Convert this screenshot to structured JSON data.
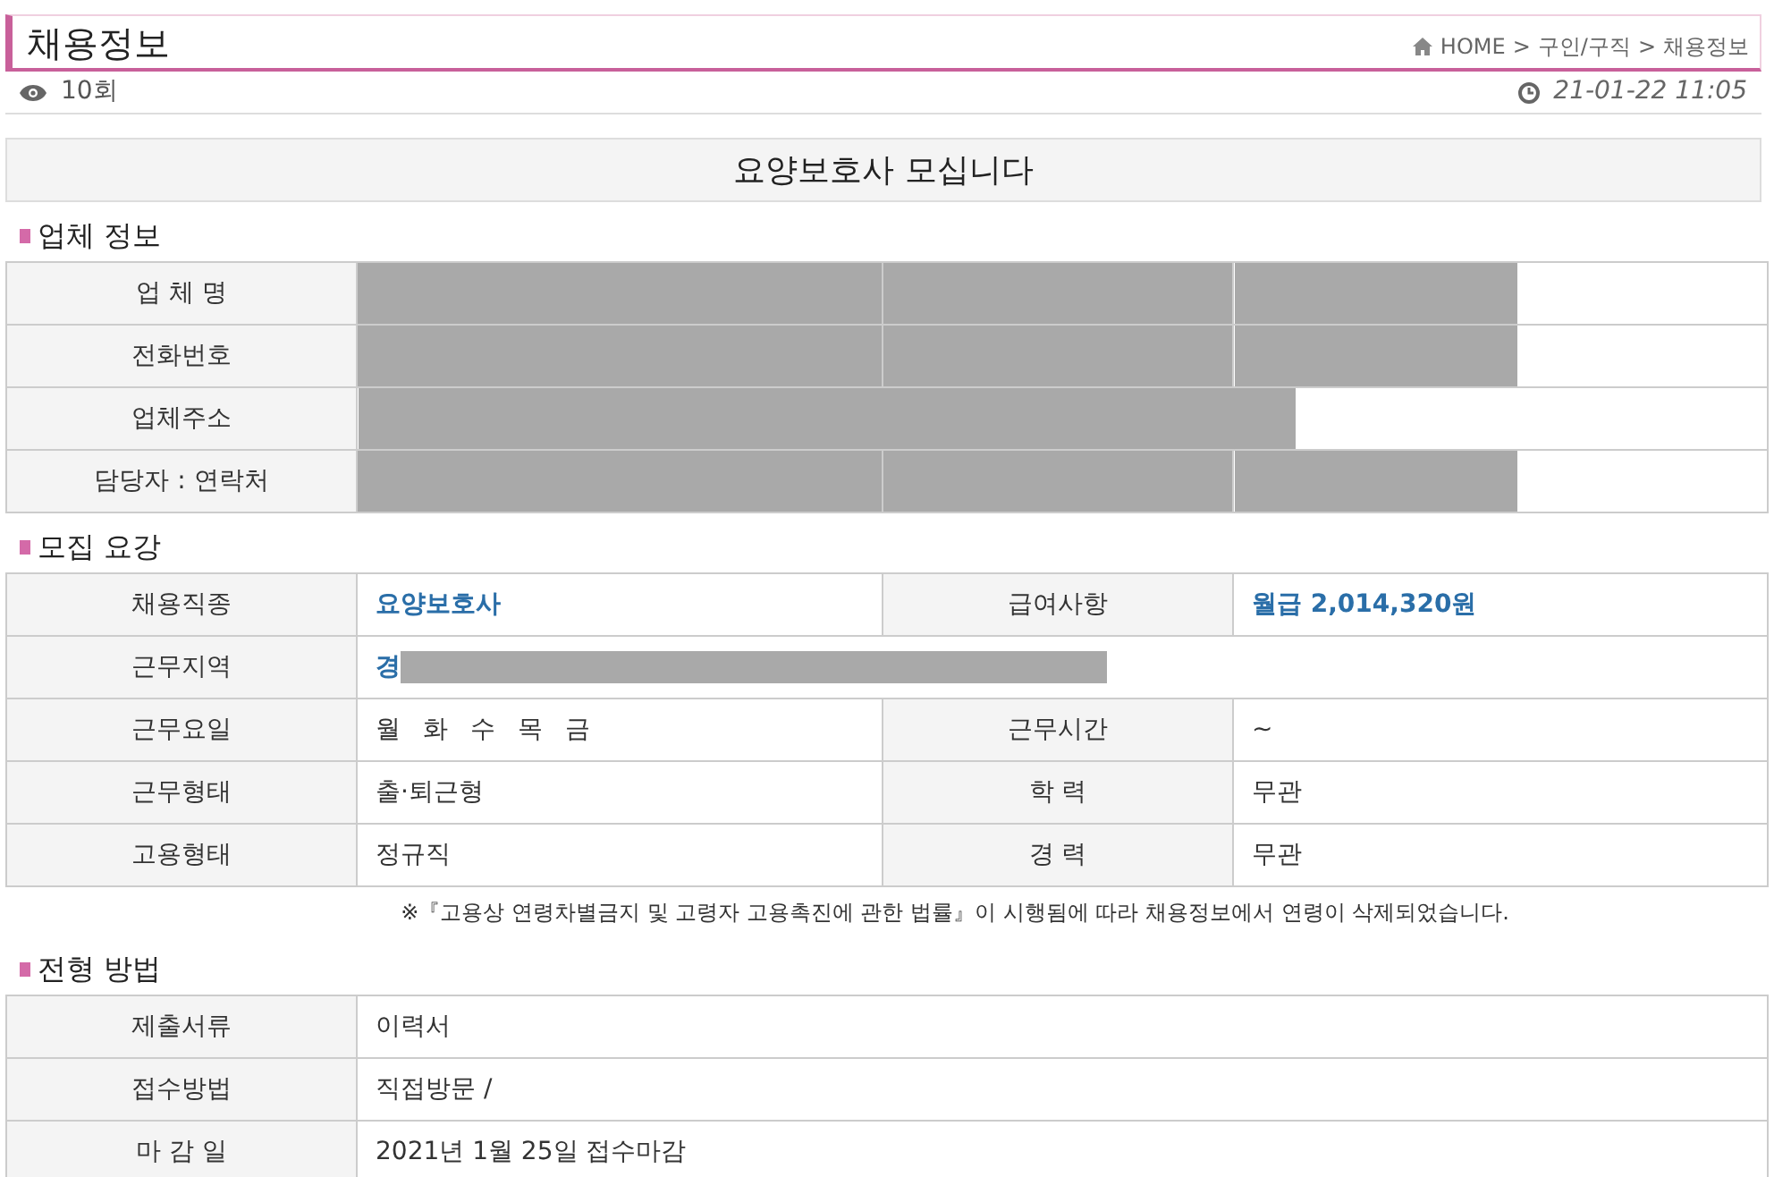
{
  "page_title": "채용정보",
  "breadcrumb": [
    {
      "label": "HOME",
      "kind": "home"
    },
    {
      "label": ">",
      "kind": "separator"
    },
    {
      "label": "구인/구직",
      "kind": "link"
    },
    {
      "label": ">",
      "kind": "separator"
    },
    {
      "label": "채용정보",
      "kind": "link"
    }
  ],
  "views": "10회",
  "posted": "21-01-22 11:05",
  "headline": "요양보호사 모십니다",
  "sections": [
    {
      "title": "업체 정보",
      "rows": [
        {
          "cells": [
            {
              "text": "업 체 명",
              "kind": "label",
              "redacted": false
            },
            {
              "kind": "value",
              "redacted": true
            },
            {
              "kind": "label",
              "redacted": true
            },
            {
              "kind": "value",
              "redacted": true
            }
          ]
        },
        {
          "cells": [
            {
              "text": "전화번호",
              "kind": "label",
              "redacted": false
            },
            {
              "kind": "value",
              "redacted": true
            },
            {
              "kind": "label",
              "redacted": true
            },
            {
              "kind": "value",
              "redacted": true
            }
          ]
        },
        {
          "cells": [
            {
              "text": "업체주소",
              "kind": "label",
              "redacted": false
            },
            {
              "kind": "value",
              "colspan": 3,
              "redacted": true
            }
          ]
        },
        {
          "cells": [
            {
              "text": "담당자 : 연락처",
              "kind": "label",
              "redacted": false
            },
            {
              "kind": "value",
              "redacted": true
            },
            {
              "kind": "label",
              "redacted": true
            },
            {
              "kind": "value",
              "redacted": true
            }
          ]
        }
      ]
    },
    {
      "title": "모집 요강",
      "rows": [
        {
          "cells": [
            {
              "text": "채용직종",
              "kind": "label",
              "redacted": false
            },
            {
              "text": "요양보호사",
              "kind": "highlight",
              "redacted": false
            },
            {
              "text": "급여사항",
              "kind": "label",
              "redacted": false
            },
            {
              "text": "월급 2,014,320원",
              "kind": "highlight",
              "redacted": false
            }
          ]
        },
        {
          "cells": [
            {
              "text": "근무지역",
              "kind": "label",
              "redacted": false
            },
            {
              "text": "경",
              "kind": "highlight",
              "colspan": 3,
              "redacted": true
            }
          ]
        },
        {
          "cells": [
            {
              "text": "근무요일",
              "kind": "label",
              "redacted": false
            },
            {
              "text": "월 화 수 목 금",
              "kind": "spaced",
              "redacted": false
            },
            {
              "text": "근무시간",
              "kind": "label",
              "redacted": false
            },
            {
              "text": "~",
              "kind": "value",
              "redacted": false
            }
          ]
        },
        {
          "cells": [
            {
              "text": "근무형태",
              "kind": "label",
              "redacted": false
            },
            {
              "text": "출·퇴근형",
              "kind": "value",
              "redacted": false
            },
            {
              "text": "학 력",
              "kind": "label",
              "redacted": false
            },
            {
              "text": "무관",
              "kind": "value",
              "redacted": false
            }
          ]
        },
        {
          "cells": [
            {
              "text": "고용형태",
              "kind": "label",
              "redacted": false
            },
            {
              "text": "정규직",
              "kind": "value",
              "redacted": false
            },
            {
              "text": "경 력",
              "kind": "label",
              "redacted": false
            },
            {
              "text": "무관",
              "kind": "value",
              "redacted": false
            }
          ]
        }
      ],
      "notice": "※『고용상 연령차별금지 및 고령자 고용촉진에 관한 법률』이 시행됨에 따라 채용정보에서 연령이 삭제되었습니다."
    },
    {
      "title": "전형 방법",
      "rows": [
        {
          "cells": [
            {
              "text": "제출서류",
              "kind": "label",
              "redacted": false
            },
            {
              "text": "이력서",
              "kind": "value",
              "colspan": 3,
              "redacted": false
            }
          ]
        },
        {
          "cells": [
            {
              "text": "접수방법",
              "kind": "label",
              "redacted": false
            },
            {
              "text": "직접방문 /",
              "kind": "value",
              "colspan": 3,
              "redacted": false
            }
          ]
        },
        {
          "cells": [
            {
              "text": "마 감 일",
              "kind": "label",
              "redacted": false
            },
            {
              "text": "2021년 1월 25일 접수마감",
              "kind": "value",
              "colspan": 3,
              "redacted": false
            }
          ]
        }
      ]
    }
  ]
}
